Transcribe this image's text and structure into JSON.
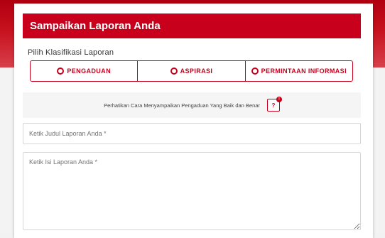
{
  "form": {
    "title": "Sampaikan Laporan Anda",
    "classification_label": "Pilih Klasifikasi Laporan",
    "options": [
      {
        "label": "PENGADUAN",
        "icon": "radio-icon"
      },
      {
        "label": "ASPIRASI",
        "icon": "radio-icon"
      },
      {
        "label": "PERMINTAAN INFORMASI",
        "icon": "radio-icon"
      }
    ],
    "notice": "Perhatikan Cara Menyampaikan Pengaduan Yang Baik dan Benar",
    "help": {
      "label": "?",
      "badge": "!"
    },
    "title_field_placeholder": "Ketik Judul Laporan Anda *",
    "body_field_placeholder": "Ketik Isi Laporan Anda *"
  },
  "colors": {
    "brand": "#c8001c",
    "background": "#f2f2f2"
  }
}
